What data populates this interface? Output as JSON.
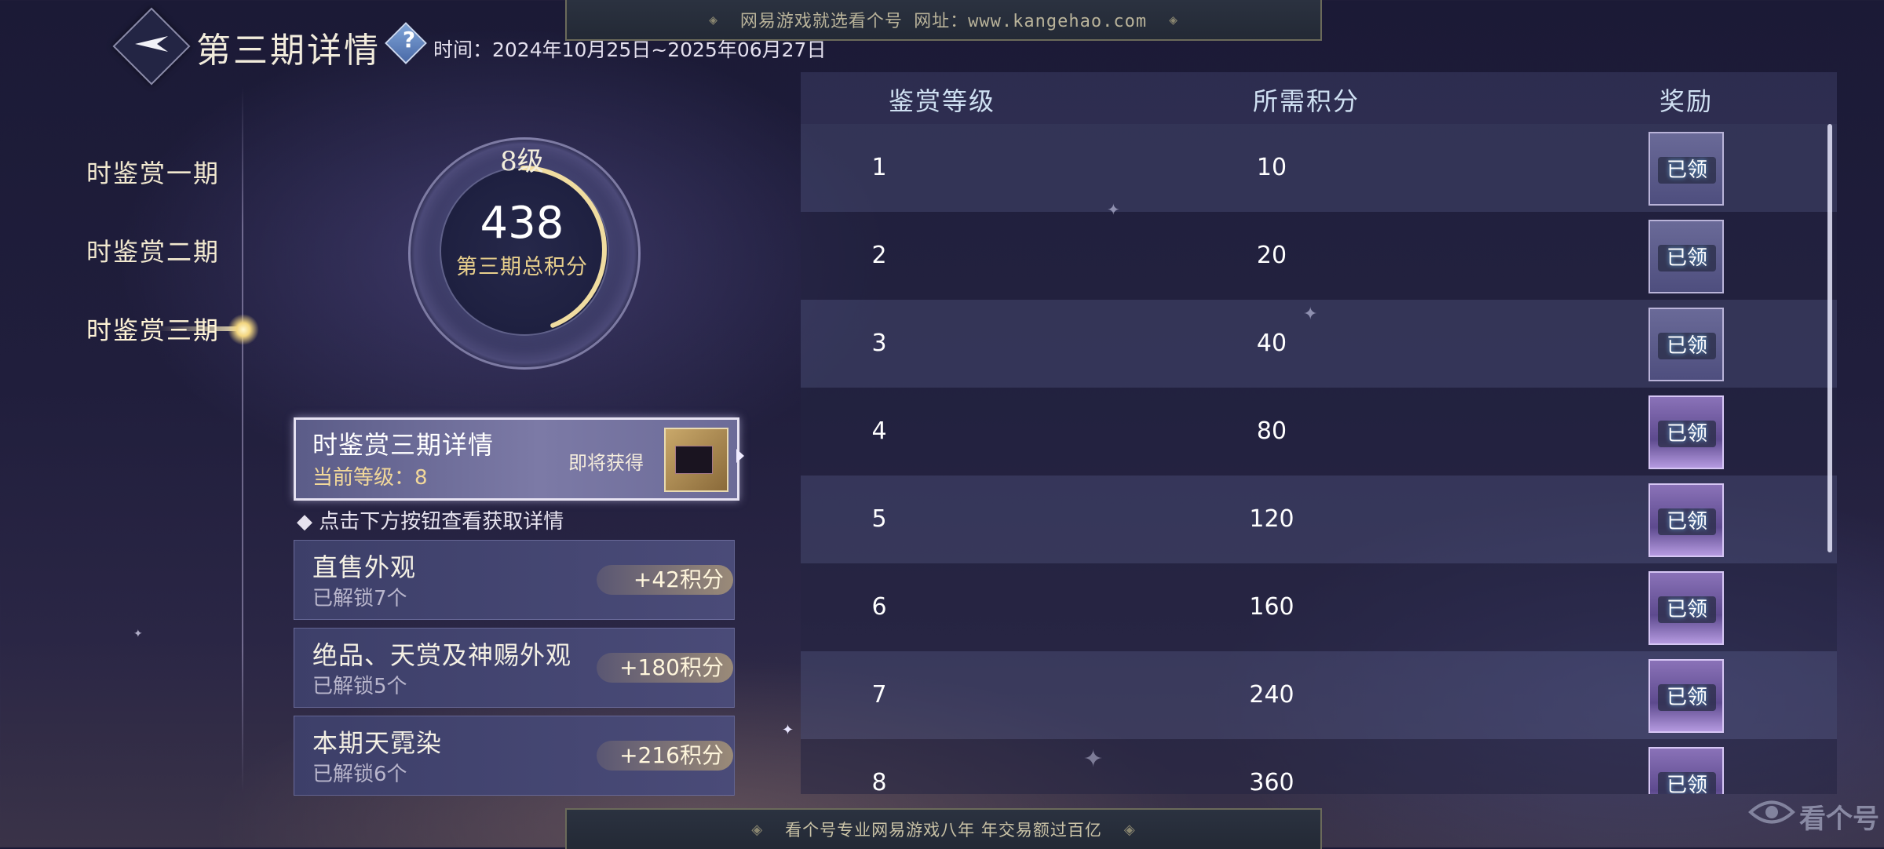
{
  "watermark": {
    "top_text": "网易游戏就选看个号  网址：www.kangehao.com",
    "bottom_text": "看个号专业网易游戏八年  年交易额过百亿",
    "corner_text": "看个号"
  },
  "header": {
    "title": "第三期详情",
    "help_label": "?",
    "time_text": "时间：2024年10月25日~2025年06月27日"
  },
  "nav": {
    "items": [
      {
        "label": "时鉴赏一期",
        "active": false
      },
      {
        "label": "时鉴赏二期",
        "active": false
      },
      {
        "label": "时鉴赏三期",
        "active": true
      }
    ]
  },
  "score": {
    "level_label": "8级",
    "total": "438",
    "total_label": "第三期总积分",
    "progress": 0.44
  },
  "detail": {
    "title": "时鉴赏三期详情",
    "current_level": "当前等级：8",
    "upcoming_label": "即将获得",
    "hint": "◆ 点击下方按钮查看获取详情"
  },
  "categories": [
    {
      "title": "直售外观",
      "unlocked": "已解锁7个",
      "points": "+42积分"
    },
    {
      "title": "绝品、天赏及神赐外观",
      "unlocked": "已解锁5个",
      "points": "+180积分"
    },
    {
      "title": "本期天霓染",
      "unlocked": "已解锁6个",
      "points": "+216积分"
    }
  ],
  "table": {
    "headers": [
      "鉴赏等级",
      "所需积分",
      "奖励"
    ],
    "rows": [
      {
        "level": "1",
        "points": "10",
        "reward_status": "已领",
        "style": "plain"
      },
      {
        "level": "2",
        "points": "20",
        "reward_status": "已领",
        "style": "plain"
      },
      {
        "level": "3",
        "points": "40",
        "reward_status": "已领",
        "style": "plain"
      },
      {
        "level": "4",
        "points": "80",
        "reward_status": "已领",
        "style": "purple"
      },
      {
        "level": "5",
        "points": "120",
        "reward_status": "已领",
        "style": "purple"
      },
      {
        "level": "6",
        "points": "160",
        "reward_status": "已领",
        "style": "purple"
      },
      {
        "level": "7",
        "points": "240",
        "reward_status": "已领",
        "style": "purple"
      },
      {
        "level": "8",
        "points": "360",
        "reward_status": "已领",
        "style": "purple"
      }
    ]
  },
  "colors": {
    "accent_gold": "#e8cf8c",
    "claimed_glow": "#78c8ff"
  }
}
